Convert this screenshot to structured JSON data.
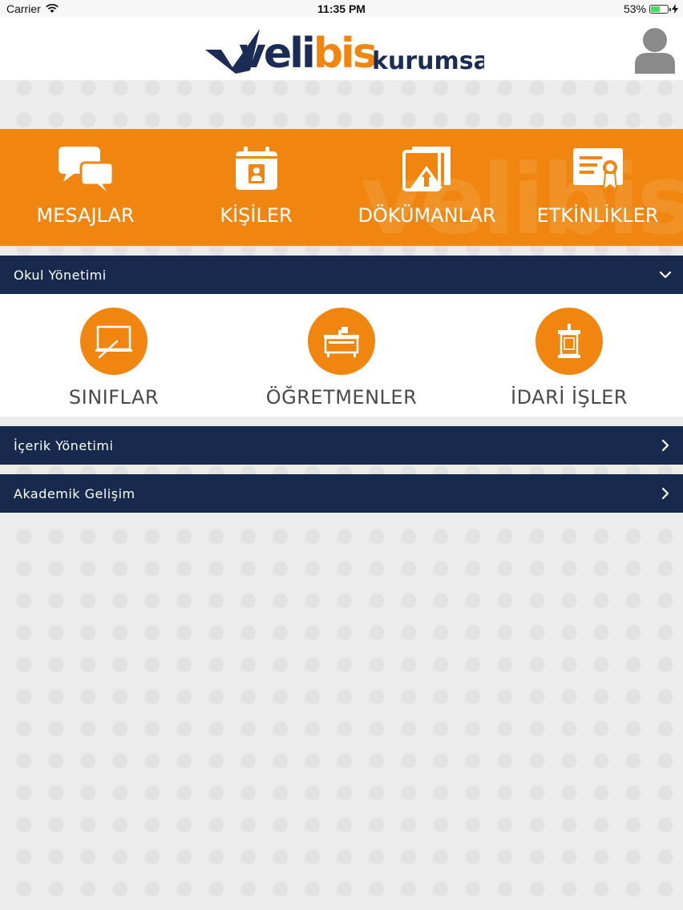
{
  "status_bar": {
    "carrier": "Carrier",
    "time": "11:35 PM",
    "battery": "53%",
    "battery_level": 0.53
  },
  "header": {
    "logo_main": "velibis",
    "logo_sub": "kurumsal"
  },
  "watermark": "velibis",
  "quick_actions": [
    {
      "label": "MESAJLAR",
      "icon": "chat-bubbles-icon"
    },
    {
      "label": "KİŞİLER",
      "icon": "contacts-calendar-icon"
    },
    {
      "label": "DÖKÜMANLAR",
      "icon": "documents-upload-icon"
    },
    {
      "label": "ETKİNLİKLER",
      "icon": "certificate-icon"
    }
  ],
  "sections": {
    "okul": {
      "title": "Okul Yönetimi",
      "expanded": true
    },
    "icerik": {
      "title": "İçerik Yönetimi",
      "expanded": false
    },
    "akademik": {
      "title": "Akademik Gelişim",
      "expanded": false
    }
  },
  "okul_items": [
    {
      "label": "SINIFLAR",
      "icon": "blackboard-icon"
    },
    {
      "label": "ÖĞRETMENLER",
      "icon": "teacher-desk-icon"
    },
    {
      "label": "İDARİ İŞLER",
      "icon": "podium-icon"
    }
  ],
  "colors": {
    "orange": "#f0860f",
    "navy": "#172a4d",
    "logo_blue": "#1c2d55"
  }
}
